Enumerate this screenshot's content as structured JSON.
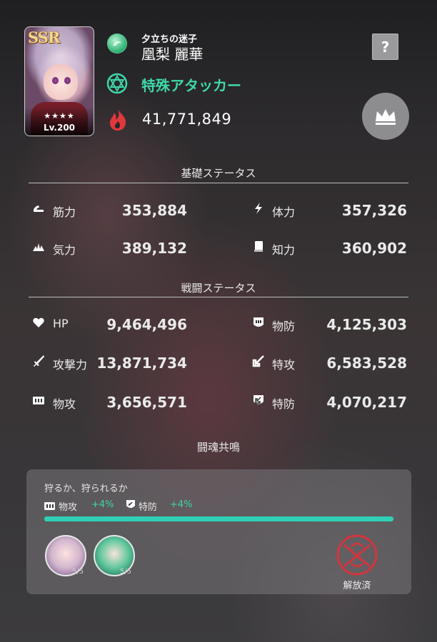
{
  "header": {
    "rarity": "SSR",
    "stars": "★★★★",
    "level": "Lv.200",
    "subtitle": "夕立ちの迷子",
    "name": "凰梨 麗華",
    "role": "特殊アタッカー",
    "power": "41,771,849",
    "help_label": "?"
  },
  "base_stats": {
    "title": "基礎ステータス",
    "items": [
      {
        "label": "筋力",
        "value": "353,884",
        "icon": "arm-icon"
      },
      {
        "label": "体力",
        "value": "357,326",
        "icon": "lightning-icon"
      },
      {
        "label": "気力",
        "value": "389,132",
        "icon": "spark-icon"
      },
      {
        "label": "知力",
        "value": "360,902",
        "icon": "book-icon"
      }
    ]
  },
  "battle_stats": {
    "title": "戦闘ステータス",
    "items": [
      {
        "label": "HP",
        "value": "9,464,496",
        "icon": "heart-icon"
      },
      {
        "label": "物防",
        "value": "4,125,303",
        "icon": "physical-defense-icon"
      },
      {
        "label": "攻撃力",
        "value": "13,871,734",
        "icon": "sword-icon"
      },
      {
        "label": "特攻",
        "value": "6,583,528",
        "icon": "special-attack-icon"
      },
      {
        "label": "物攻",
        "value": "3,656,571",
        "icon": "physical-attack-icon"
      },
      {
        "label": "特防",
        "value": "4,070,217",
        "icon": "special-defense-icon"
      }
    ]
  },
  "resonance": {
    "title": "闘魂共鳴",
    "caption": "狩るか、狩られるか",
    "bonuses": [
      {
        "label": "物攻",
        "value": "+4%"
      },
      {
        "label": "特防",
        "value": "+4%"
      }
    ],
    "progress": 1.0,
    "members": [
      {
        "count": "5/5"
      },
      {
        "count": "5/5"
      }
    ],
    "status": "解放済"
  },
  "colors": {
    "accent": "#3fd7a9",
    "bar": "#2fd0b4",
    "released": "#d6343c"
  }
}
